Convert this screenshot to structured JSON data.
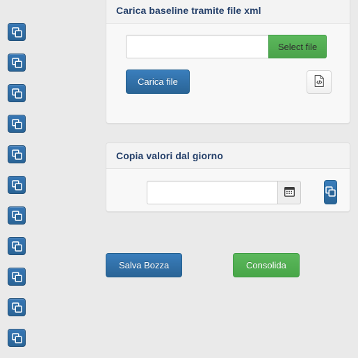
{
  "sidebar": {
    "buttons": [
      {
        "icon": "copy-icon",
        "title": "Copia"
      },
      {
        "icon": "copy-icon",
        "title": "Copia"
      },
      {
        "icon": "copy-icon",
        "title": "Copia"
      },
      {
        "icon": "copy-icon",
        "title": "Copia"
      },
      {
        "icon": "copy-icon",
        "title": "Copia"
      },
      {
        "icon": "copy-icon",
        "title": "Copia"
      },
      {
        "icon": "copy-icon",
        "title": "Copia"
      },
      {
        "icon": "copy-icon",
        "title": "Copia"
      },
      {
        "icon": "copy-icon",
        "title": "Copia"
      },
      {
        "icon": "copy-icon",
        "title": "Copia"
      },
      {
        "icon": "copy-icon",
        "title": "Copia"
      }
    ]
  },
  "panels": {
    "upload": {
      "title": "Carica baseline tramite file xml",
      "file_input": {
        "value": "",
        "placeholder": ""
      },
      "select_file_label": "Select file",
      "upload_button_label": "Carica file",
      "template_icon": "file-code-icon"
    },
    "copy_day": {
      "title": "Copia valori dal giorno",
      "day_input": {
        "value": "",
        "placeholder": ""
      },
      "calendar_icon": "calendar-icon",
      "copy_icon": "copy-icon"
    }
  },
  "bottom_actions": {
    "draft_label": "Salva Bozza",
    "consolidate_label": "Consolida"
  },
  "colors": {
    "page_background": "#eaeaea",
    "panel_background": "#f8f8f8",
    "panel_heading_background": "#f3f3f3",
    "panel_title": "#243f69",
    "primary": "#2a6496",
    "success": "#5cb85c",
    "border": "#dddddd"
  }
}
